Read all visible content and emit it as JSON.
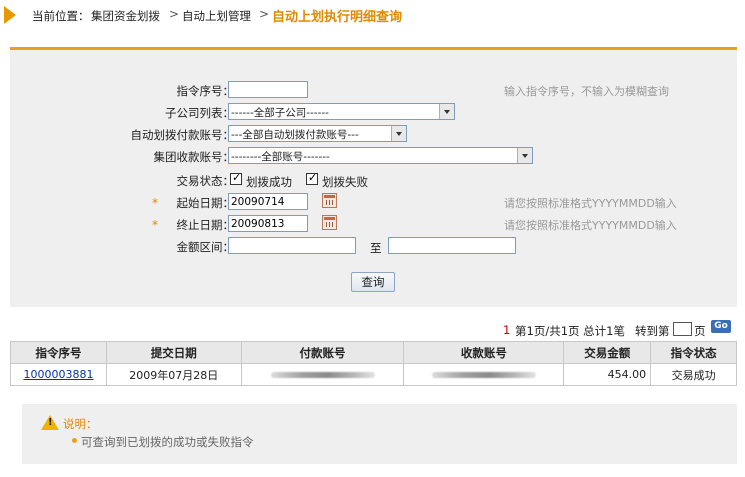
{
  "breadcrumb": {
    "prefix": "当前位置：",
    "items": [
      "集团资金划拨",
      "自动上划管理"
    ],
    "separator": ">",
    "current": "自动上划执行明细查询"
  },
  "form": {
    "instruction_no": {
      "label": "指令序号：",
      "value": "",
      "hint": "输入指令序号，不输入为模糊查询"
    },
    "subsidiary": {
      "label": "子公司列表：",
      "selected": "------全部子公司------"
    },
    "auto_pay_account": {
      "label": "自动划拨付款账号：",
      "selected": "---全部自动划拨付款账号---"
    },
    "group_receive_account": {
      "label": "集团收款账号：",
      "selected": "--------全部账号-------"
    },
    "status": {
      "label": "交易状态：",
      "options": [
        {
          "label": "划拨成功",
          "checked": true
        },
        {
          "label": "划拨失败",
          "checked": true
        }
      ]
    },
    "required_mark": "*",
    "start_date": {
      "label": "起始日期：",
      "value": "20090714",
      "hint": "请您按照标准格式YYYYMMDD输入"
    },
    "end_date": {
      "label": "终止日期：",
      "value": "20090813",
      "hint": "请您按照标准格式YYYYMMDD输入"
    },
    "amount_range": {
      "label": "金额区间：",
      "from": "",
      "to_label": "至",
      "to": ""
    },
    "query_button": "查询"
  },
  "pager": {
    "current_page": "1",
    "text": "第1页/共1页 总计1笔",
    "goto_label": "转到第",
    "page_unit": "页",
    "go_button": "Go"
  },
  "table": {
    "columns": [
      "指令序号",
      "提交日期",
      "付款账号",
      "收款账号",
      "交易金额",
      "指令状态"
    ],
    "rows": [
      {
        "instruction_no": "1000003881",
        "date": "2009年07月28日",
        "amount": "454.00",
        "status": "交易成功"
      }
    ]
  },
  "note": {
    "title": "说明：",
    "items": [
      "可查询到已划拨的成功或失败指令"
    ]
  },
  "colors": {
    "accent": "#e5a21a",
    "title": "#e08a00",
    "panel": "#efefef",
    "link": "#0033aa"
  }
}
